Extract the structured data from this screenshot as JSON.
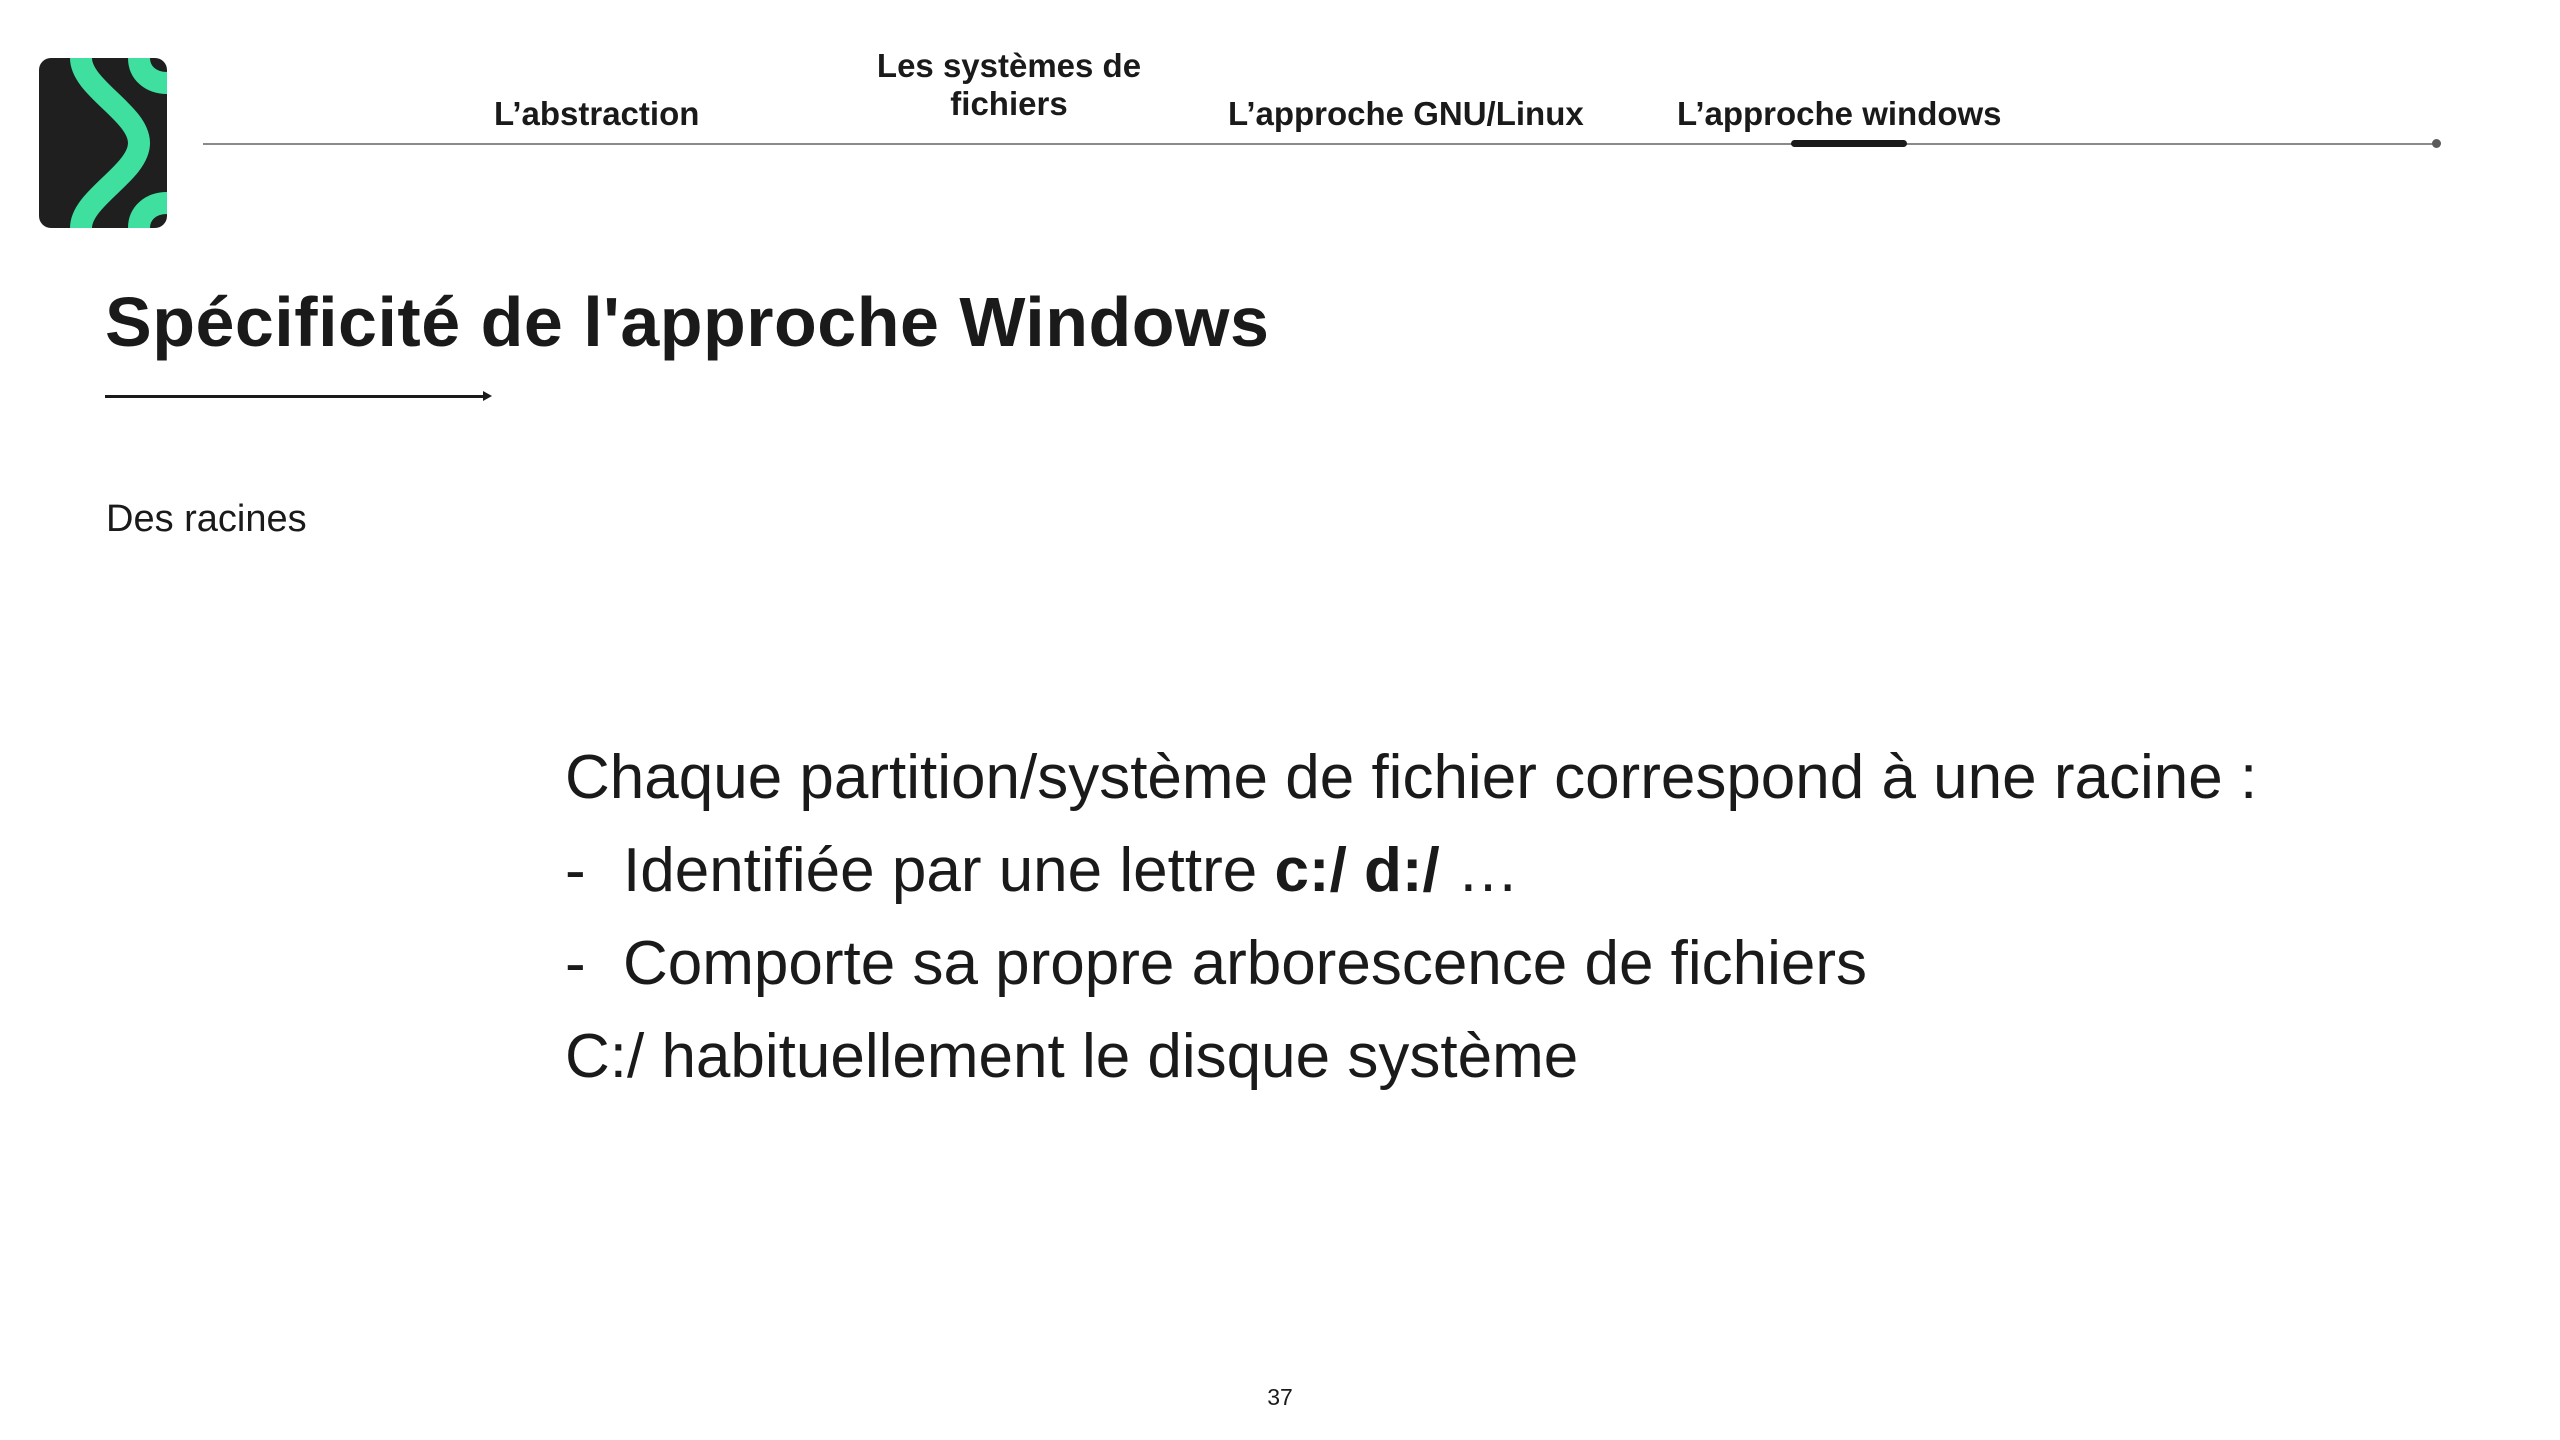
{
  "colors": {
    "logo_bg": "#1f1f1f",
    "logo_accent": "#3fe09f",
    "text": "#1a1a1a"
  },
  "nav": {
    "items": [
      {
        "label": "L’abstraction"
      },
      {
        "label": "Les systèmes de fichiers"
      },
      {
        "label": "L’approche GNU/Linux"
      },
      {
        "label": "L’approche windows",
        "active": true
      }
    ]
  },
  "slide": {
    "title": "Spécificité de l'approche Windows",
    "subtitle": "Des racines",
    "body": {
      "line1": "Chaque partition/système de fichier correspond à une racine :",
      "bullet_dash": "-",
      "bullet1_text": "Identifiée par une lettre ",
      "bullet1_bold": "c:/ d:/",
      "bullet1_suffix": " …",
      "bullet2_text": "Comporte sa propre arborescence de fichiers",
      "line4": "C:/ habituellement le disque système"
    },
    "page_number": "37"
  }
}
